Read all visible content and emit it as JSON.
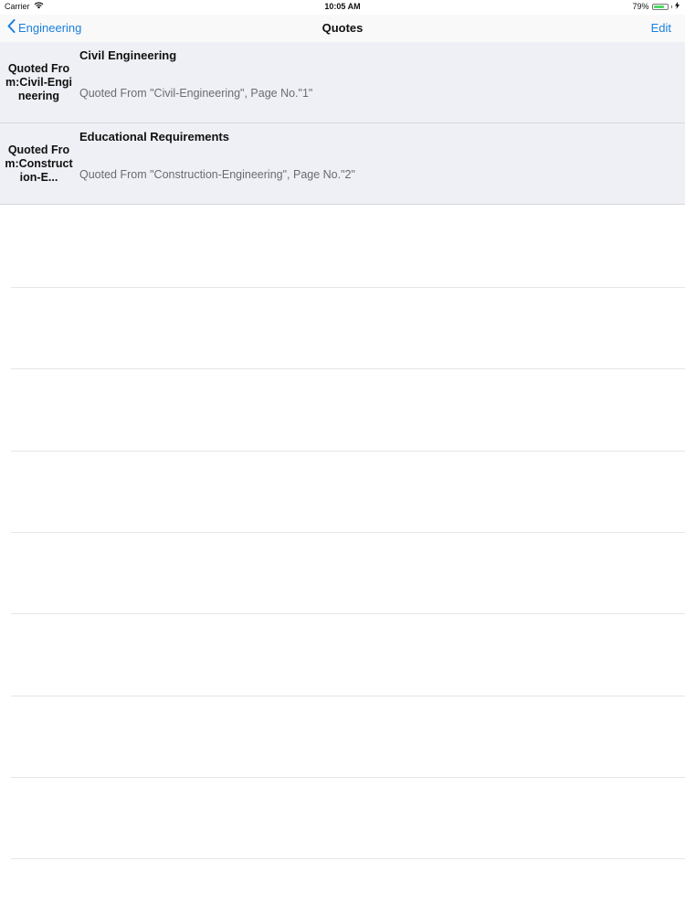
{
  "status_bar": {
    "carrier": "Carrier",
    "time": "10:05 AM",
    "battery_percent": "79%",
    "battery_level": 0.79,
    "icons": [
      "wifi-icon",
      "battery-icon",
      "charging-icon"
    ]
  },
  "nav": {
    "back_label": "Engineering",
    "title": "Quotes",
    "edit_label": "Edit"
  },
  "quotes": [
    {
      "side_label": "Quoted From:Civil-Engineering",
      "title": "Civil Engineering",
      "subtitle": "Quoted From \"Civil-Engineering\", Page No.\"1\""
    },
    {
      "side_label": "Quoted From:Construction-E...",
      "title": "Educational Requirements",
      "subtitle": "Quoted From \"Construction-Engineering\", Page No.\"2\""
    }
  ],
  "colors": {
    "accent": "#1a7fdc",
    "row_background": "#eff0f5",
    "subtitle": "#6b6b70",
    "battery": "#4cd964"
  }
}
